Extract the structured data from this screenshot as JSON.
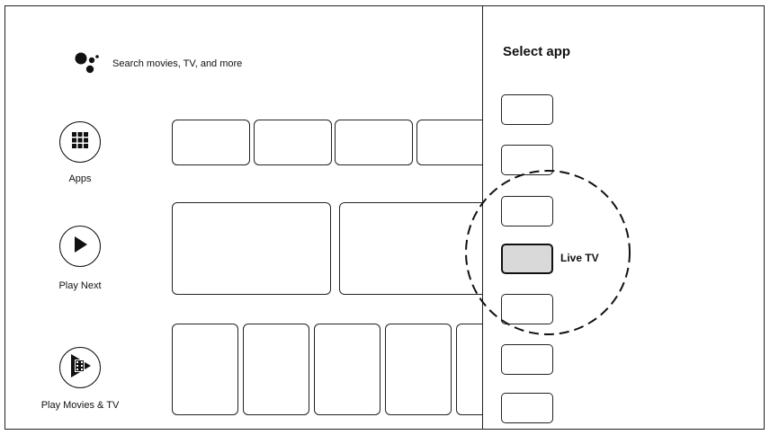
{
  "search": {
    "placeholder_text": "Search movies, TV, and more",
    "icon": "google-assistant-icon"
  },
  "nav": [
    {
      "label": "Apps",
      "icon": "apps-grid-icon"
    },
    {
      "label": "Play Next",
      "icon": "play-icon"
    },
    {
      "label": "Play Movies & TV",
      "icon": "play-movies-icon"
    }
  ],
  "select_app_panel": {
    "title": "Select app",
    "selected_app_label": "Live TV",
    "app_slot_count": 7,
    "selected_index": 3,
    "selected_fill": "#d9d9d9"
  }
}
